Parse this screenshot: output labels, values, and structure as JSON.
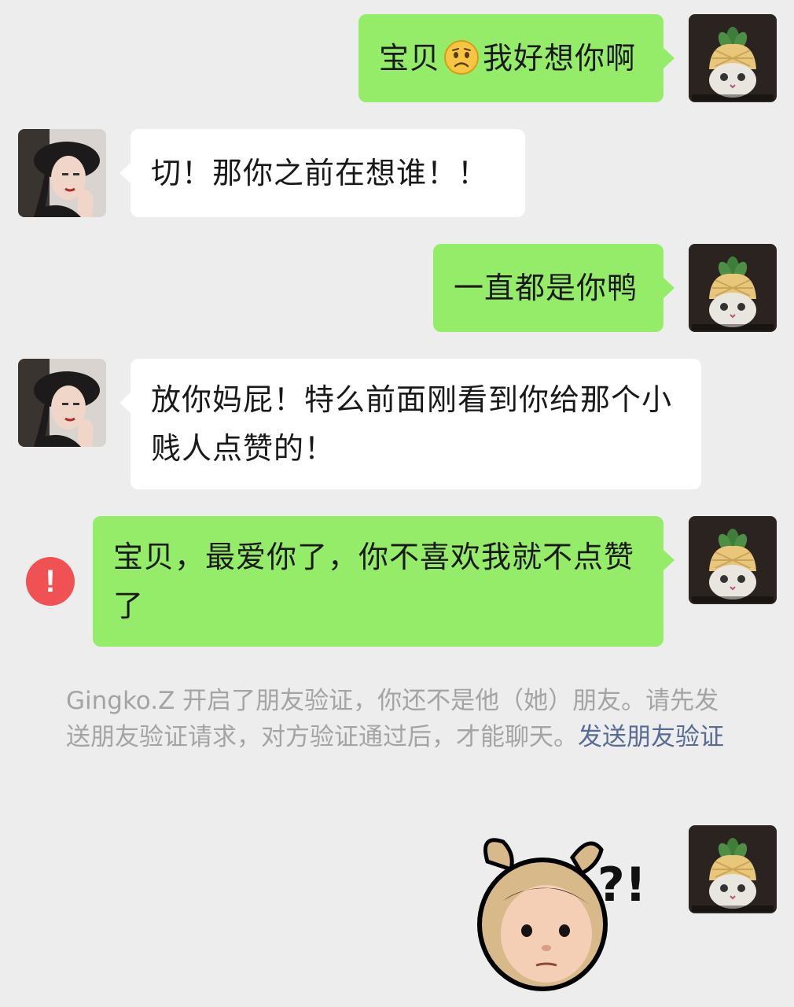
{
  "messages": [
    {
      "side": "me",
      "before_emoji": "宝贝",
      "emoji": "sad-face-emoji",
      "after_emoji": "我好想你啊"
    },
    {
      "side": "them",
      "text": "切！那你之前在想谁！！"
    },
    {
      "side": "me",
      "text": "一直都是你鸭"
    },
    {
      "side": "them",
      "text": "放你妈屁！特么前面刚看到你给那个小贱人点赞的！"
    },
    {
      "side": "me",
      "text": "宝贝，最爱你了，你不喜欢我就不点赞了",
      "status": "send-failed"
    }
  ],
  "error_mark": "!",
  "system_notice": {
    "text": "Gingko.Z 开启了朋友验证，你还不是他（她）朋友。请先发送朋友验证请求，对方验证通过后，才能聊天。",
    "link": "发送朋友验证"
  },
  "sticker": {
    "caption": "?!"
  },
  "colors": {
    "background": "#ededed",
    "my_bubble": "#95ec69",
    "their_bubble": "#ffffff",
    "error": "#f05153",
    "link": "#576b95",
    "notice_text": "#a4a4a4"
  }
}
